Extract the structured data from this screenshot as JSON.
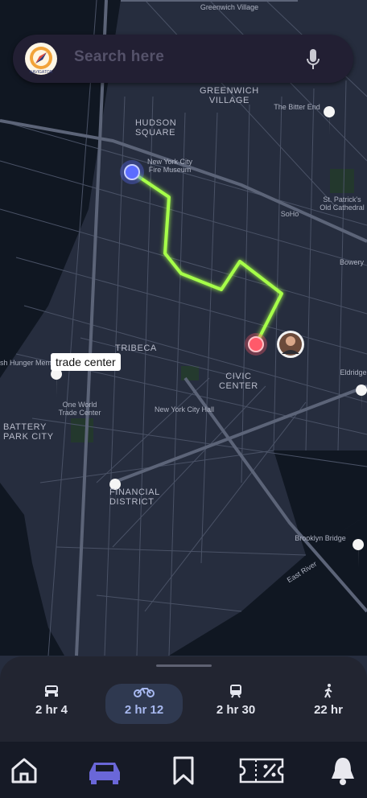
{
  "search": {
    "placeholder": "Search here"
  },
  "map": {
    "labels": [
      {
        "id": "greenwich-village-top",
        "text": "Greenwich Village"
      },
      {
        "id": "greenwich-village",
        "text": "GREENWICH\nVILLAGE"
      },
      {
        "id": "bitter-end",
        "text": "The Bitter End"
      },
      {
        "id": "hudson-square",
        "text": "HUDSON\nSQUARE"
      },
      {
        "id": "fire-museum",
        "text": "New York City\nFire Museum"
      },
      {
        "id": "soho",
        "text": "SoHo"
      },
      {
        "id": "st-patricks",
        "text": "St. Patrick's\nOld Cathedral"
      },
      {
        "id": "bowery",
        "text": "Bowery"
      },
      {
        "id": "tribeca",
        "text": "TRIBECA"
      },
      {
        "id": "civic-center",
        "text": "CIVIC\nCENTER"
      },
      {
        "id": "city-hall",
        "text": "New York City Hall"
      },
      {
        "id": "one-world",
        "text": "One World\nTrade Center"
      },
      {
        "id": "battery-park",
        "text": "BATTERY\nPARK CITY"
      },
      {
        "id": "hunger",
        "text": "sh Hunger Mem"
      },
      {
        "id": "financial",
        "text": "FINANCIAL\nDISTRICT"
      },
      {
        "id": "brooklyn-bridge",
        "text": "Brooklyn Bridge"
      },
      {
        "id": "eldridge",
        "text": "Eldridge"
      },
      {
        "id": "east-river",
        "text": "East River"
      }
    ],
    "callout": "trade center"
  },
  "travel_modes": [
    {
      "id": "car",
      "icon": "car-icon",
      "time": "2 hr 4"
    },
    {
      "id": "bike",
      "icon": "motorbike-icon",
      "time": "2 hr 12",
      "active": true
    },
    {
      "id": "transit",
      "icon": "train-icon",
      "time": "2 hr 30"
    },
    {
      "id": "walk",
      "icon": "walking-icon",
      "time": "22 hr"
    }
  ],
  "nav": [
    {
      "id": "home",
      "icon": "home-icon"
    },
    {
      "id": "car",
      "icon": "car-icon",
      "active": true
    },
    {
      "id": "saved",
      "icon": "bookmark-icon"
    },
    {
      "id": "tickets",
      "icon": "ticket-percent-icon"
    },
    {
      "id": "alerts",
      "icon": "bell-icon"
    }
  ],
  "colors": {
    "route": "#a6ff4a",
    "origin": "#5b6cff",
    "destination": "#ff5a6a",
    "accent": "#6a67d8"
  },
  "logo_text": "NAVIGATOR"
}
